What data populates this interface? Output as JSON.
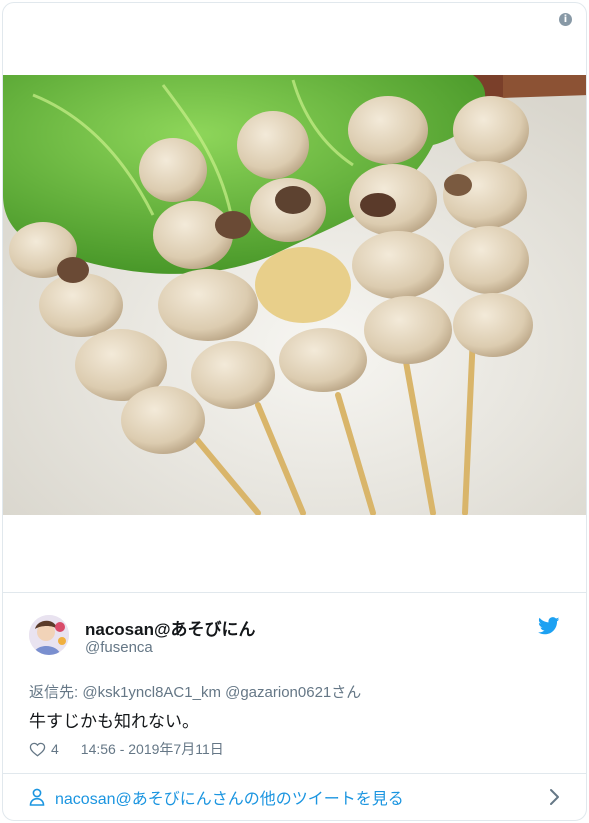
{
  "tweet": {
    "info_symbol": "i",
    "author": {
      "display_name": "nacosan@あそびにん",
      "handle": "@fusenca"
    },
    "reply_to": {
      "prefix": "返信先: ",
      "mentions": "@ksk1yncl8AC1_km @gazarion0621",
      "suffix": "さん"
    },
    "text": "牛すじかも知れない。",
    "likes": "4",
    "timestamp": "14:56 - 2019年7月11日",
    "more_link": "nacosan@あそびにんさんの他のツイートを見る",
    "image": {
      "subject": "grilled skewers on lettuce",
      "skewer_count": 5
    }
  },
  "colors": {
    "accent": "#1da1f2",
    "link": "#1b95e0",
    "muted": "#657786",
    "border": "#e1e8ed",
    "text": "#14171a"
  },
  "icons": [
    "info-icon",
    "twitter-bird-icon",
    "heart-icon",
    "person-icon",
    "chevron-right-icon"
  ]
}
